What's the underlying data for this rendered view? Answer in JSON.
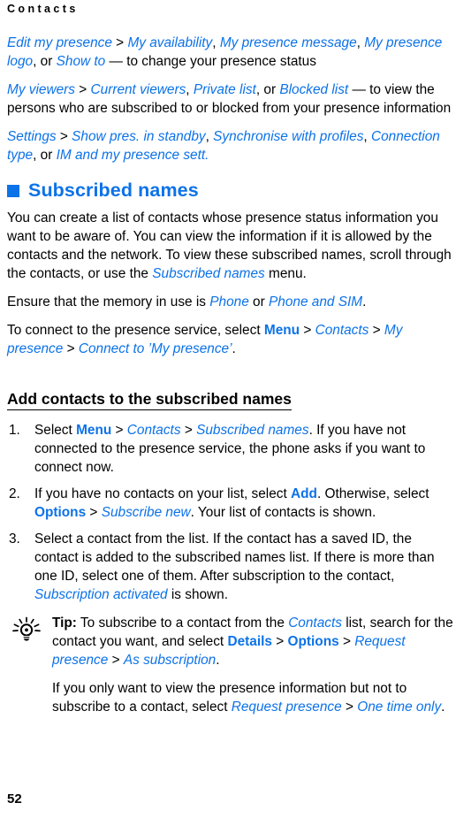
{
  "document": {
    "running_header": "Contacts",
    "page_number": "52",
    "accent_color": "#0c72e8",
    "text_color": "#000000",
    "background_color": "#ffffff"
  },
  "intro": {
    "paragraph_1": {
      "p1_item_1": "Edit my presence",
      "p1_sep_1": " > ",
      "p1_item_2": "My availability",
      "p1_comma_1": ", ",
      "p1_item_3": "My presence message",
      "p1_comma_2": ", ",
      "p1_item_4": "My presence logo",
      "p1_or": ", or ",
      "p1_item_5": "Show to",
      "p1_tail": " — to change your presence status"
    },
    "paragraph_2": {
      "p2_item_1": "My viewers",
      "p2_sep_1": " > ",
      "p2_item_2": "Current viewers",
      "p2_comma_1": ", ",
      "p2_item_3": "Private list",
      "p2_or": ", or ",
      "p2_item_4": "Blocked list",
      "p2_tail": " — to view the persons who are subscribed to or blocked from your presence information"
    },
    "paragraph_3": {
      "p3_item_1": "Settings",
      "p3_sep_1": " > ",
      "p3_item_2": "Show pres. in standby",
      "p3_comma_1": ", ",
      "p3_item_3": "Synchronise with profiles",
      "p3_comma_2": ", ",
      "p3_item_4": "Connection type",
      "p3_or": ", or ",
      "p3_item_5": "IM and my presence sett."
    }
  },
  "section": {
    "title": "Subscribed names",
    "bullet_icon": "filled-square-bullet",
    "paragraph_1": {
      "lead": "You can create a list of contacts whose presence status information you want to be aware of. You can view the information if it is allowed by the contacts and the network. To view these subscribed names, scroll through the contacts, or use the ",
      "item_1": "Subscribed names",
      "tail": " menu."
    },
    "paragraph_2": {
      "lead": "Ensure that the memory in use is ",
      "item_1": "Phone",
      "mid": " or ",
      "item_2": "Phone and SIM",
      "tail": "."
    },
    "paragraph_3": {
      "lead": "To connect to the presence service, select ",
      "cmd_1": "Menu",
      "sep_1": " > ",
      "item_1": "Contacts",
      "sep_2": " > ",
      "item_2": "My presence",
      "sep_3": " > ",
      "item_3": "Connect to ’My presence’",
      "tail": "."
    }
  },
  "subsection": {
    "title": "Add contacts to the subscribed names",
    "steps": [
      {
        "number": "1.",
        "lead": "Select ",
        "cmd_1": "Menu",
        "sep_1": " > ",
        "item_1": "Contacts",
        "sep_2": " > ",
        "item_2": "Subscribed names",
        "tail": ". If you have not connected to the presence service, the phone asks if you want to connect now."
      },
      {
        "number": "2.",
        "lead": "If you have no contacts on your list, select ",
        "cmd_1": "Add",
        "mid_1": ". Otherwise, select ",
        "cmd_2": "Options",
        "sep_1": " > ",
        "item_1": "Subscribe new",
        "tail": ". Your list of contacts is shown."
      },
      {
        "number": "3.",
        "lead": "Select a contact from the list. If the contact has a saved ID, the contact is added to the subscribed names list. If there is more than one ID, select one of them. After subscription to the contact, ",
        "item_1": "Subscription activated",
        "tail": " is shown."
      }
    ]
  },
  "tip": {
    "icon": "lightbulb-icon",
    "label": "Tip:",
    "paragraph_1": {
      "lead": " To subscribe to a contact from the ",
      "item_1": "Contacts",
      "mid_1": " list, search for the contact you want, and select ",
      "cmd_1": "Details",
      "sep_1": " > ",
      "cmd_2": "Options",
      "sep_2": " > ",
      "item_2": "Request presence",
      "sep_3": " > ",
      "item_3": "As subscription",
      "tail": "."
    },
    "paragraph_2": {
      "lead": "If you only want to view the presence information but not to subscribe to a contact, select ",
      "item_1": "Request presence",
      "sep_1": " > ",
      "item_2": "One time only",
      "tail": "."
    }
  }
}
